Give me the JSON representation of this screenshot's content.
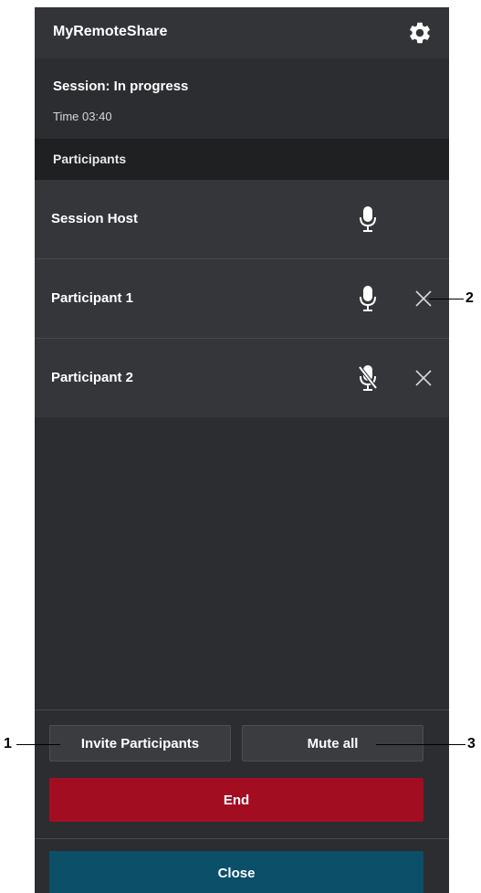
{
  "app": {
    "title": "MyRemoteShare",
    "settings_icon": "gear-icon"
  },
  "session": {
    "status": "Session: In progress",
    "time": "Time 03:40"
  },
  "participants_section": {
    "label": "Participants"
  },
  "participants": [
    {
      "name": "Session Host",
      "mic_icon": "microphone-icon",
      "muted": false,
      "removable": false
    },
    {
      "name": "Participant 1",
      "mic_icon": "microphone-icon",
      "muted": false,
      "removable": true
    },
    {
      "name": "Participant 2",
      "mic_icon": "microphone-muted-icon",
      "muted": true,
      "removable": true
    }
  ],
  "actions": {
    "invite_label": "Invite Participants",
    "mute_all_label": "Mute all",
    "end_label": "End",
    "close_label": "Close"
  },
  "callouts": {
    "invite": "1",
    "remove": "2",
    "mute_all": "3"
  },
  "colors": {
    "panel_bg": "#2b2d30",
    "end_button": "#a30d22",
    "close_button": "#0b4f69"
  }
}
